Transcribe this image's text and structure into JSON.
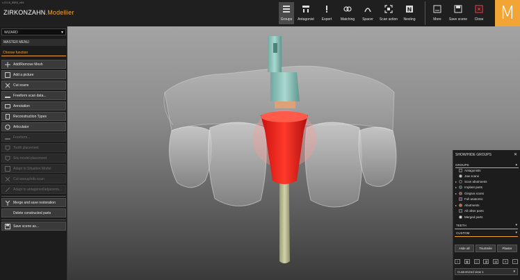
{
  "app": {
    "version": "v.3.0.8_5583_x64",
    "brand": "ZIRKONZAHN",
    "product": ".Modellier",
    "logo_letter": "M",
    "accent": "#f2a435"
  },
  "toolbar": {
    "buttons": [
      {
        "label": "Groups",
        "icon": "groups-icon",
        "active": true
      },
      {
        "label": "Antagonist",
        "icon": "antagonist-icon"
      },
      {
        "label": "Expert",
        "icon": "expert-icon"
      },
      {
        "label": "Matching",
        "icon": "matching-icon"
      },
      {
        "label": "Spacer",
        "icon": "spacer-icon"
      },
      {
        "label": "Scan action",
        "icon": "scan-action-icon"
      },
      {
        "label": "Nesting",
        "icon": "nesting-icon"
      },
      {
        "label": "More",
        "icon": "more-icon"
      },
      {
        "label": "Save scene",
        "icon": "save-icon"
      },
      {
        "label": "Close",
        "icon": "close-icon"
      }
    ]
  },
  "left_panel": {
    "wizard": "WIZARD",
    "master_menu": "MASTER MENU",
    "choose_function": "Choose function",
    "functions": [
      {
        "label": "Add/Remove Mesh",
        "icon": "mesh-icon",
        "enabled": true
      },
      {
        "label": "Add a picture",
        "icon": "picture-icon",
        "enabled": true
      },
      {
        "label": "Cut scans",
        "icon": "scissors-icon",
        "enabled": true
      },
      {
        "label": "Freeform scan data...",
        "icon": "freeform-icon",
        "enabled": true
      },
      {
        "label": "Annotation",
        "icon": "annotation-icon",
        "enabled": true
      },
      {
        "label": "Reconstruction Types",
        "icon": "reconstruction-icon",
        "enabled": true
      },
      {
        "label": "Articulator",
        "icon": "articulator-icon",
        "enabled": true
      },
      {
        "label": "Freeform...",
        "icon": "freeform-icon",
        "enabled": false
      },
      {
        "label": "Tooth placement",
        "icon": "tooth-icon",
        "enabled": false
      },
      {
        "label": "Situ model placement",
        "icon": "situ-icon",
        "enabled": false
      },
      {
        "label": "Adapt to Situation Model",
        "icon": "adapt-icon",
        "enabled": false
      },
      {
        "label": "Cut waxup/situ scan",
        "icon": "cut-icon",
        "enabled": false
      },
      {
        "label": "Adapt to antagonist/adjacents...",
        "icon": "adapt-icon",
        "enabled": false
      },
      {
        "label": "Merge and save restoration",
        "icon": "merge-icon",
        "enabled": true
      },
      {
        "label": "Delete constructed parts",
        "icon": "delete-icon",
        "enabled": true
      },
      {
        "label": "Save scene as...",
        "icon": "save-icon",
        "enabled": true
      }
    ]
  },
  "right_panel": {
    "title": "SHOW/HIDE GROUPS",
    "close": "✕",
    "groups_label": "GROUPS",
    "groups": [
      {
        "label": "Antagonists",
        "color": "#2a2a2a",
        "arrow": false,
        "square": true
      },
      {
        "label": "Jaw scans",
        "color": "#c8c8c8",
        "arrow": false
      },
      {
        "label": "Scan abutments",
        "color": "#222222",
        "arrow": true
      },
      {
        "label": "Implant parts",
        "color": "#2f5a3a",
        "arrow": true
      },
      {
        "label": "Gingiva scans",
        "color": "#c83a3a",
        "arrow": true
      },
      {
        "label": "Full anatomic",
        "color": "#6b1f6b",
        "arrow": false,
        "square": true
      },
      {
        "label": "Abutments",
        "color": "#d46a2a",
        "arrow": true
      },
      {
        "label": "All other parts",
        "color": "#2a2a2a",
        "arrow": false,
        "square": true
      },
      {
        "label": "Merged parts",
        "color": "#dddddd",
        "arrow": false
      }
    ],
    "teeth_label": "TEETH",
    "custom_label": "CUSTOM",
    "buttons": [
      "Hide all",
      "TriuSmile",
      "Plaster"
    ],
    "view": "Customized view 1"
  }
}
